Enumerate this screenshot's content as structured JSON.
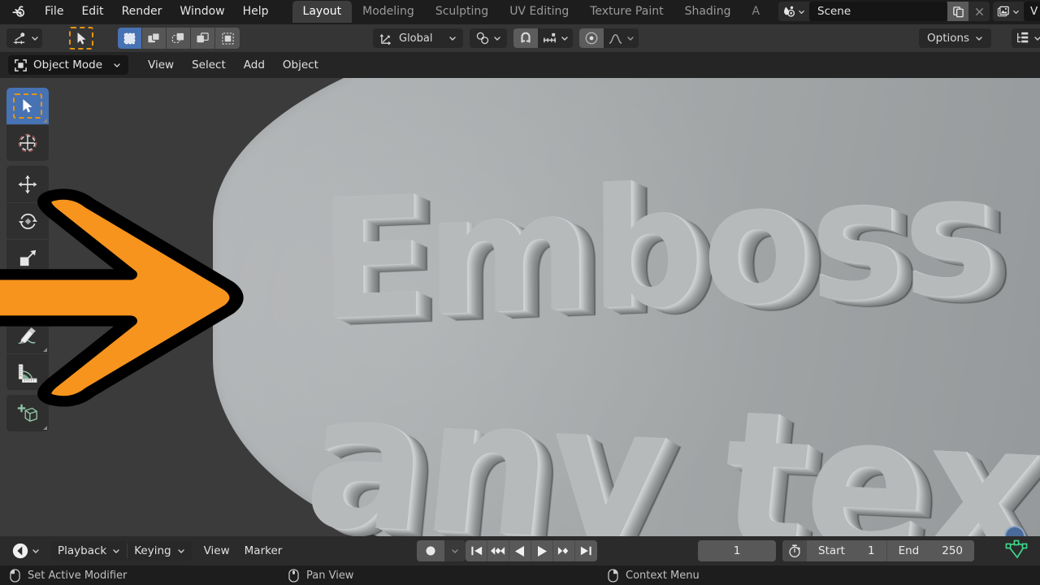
{
  "app": {
    "name": "Blender",
    "logo_icon": "blender-logo-icon"
  },
  "topbar": {
    "menus": [
      {
        "label": "File",
        "icon": ""
      },
      {
        "label": "Edit",
        "icon": ""
      },
      {
        "label": "Render",
        "icon": ""
      },
      {
        "label": "Window",
        "icon": ""
      },
      {
        "label": "Help",
        "icon": ""
      }
    ],
    "workspace_tabs": [
      {
        "label": "Layout",
        "active": true
      },
      {
        "label": "Modeling",
        "active": false
      },
      {
        "label": "Sculpting",
        "active": false
      },
      {
        "label": "UV Editing",
        "active": false
      },
      {
        "label": "Texture Paint",
        "active": false
      },
      {
        "label": "Shading",
        "active": false
      },
      {
        "label": "A",
        "active": false
      }
    ],
    "scene": {
      "icon": "scene-icon",
      "dropdown_icon": "chevron-down-icon",
      "name": "Scene",
      "duplicate_icon": "duplicate-icon",
      "close_icon": "close-icon"
    },
    "view_layer": {
      "icon": "view-layer-icon",
      "dropdown_icon": "chevron-down-icon",
      "name": "V"
    }
  },
  "tool_settings": {
    "active_tool_icon": "tweak-tool-icon",
    "active_tool_dropdown_icon": "chevron-down-icon",
    "cursor_tool_icon": "select-cursor-icon",
    "select_modes": [
      {
        "icon": "select-new-icon",
        "selected": true
      },
      {
        "icon": "select-extend-icon",
        "selected": false
      },
      {
        "icon": "select-subtract-icon",
        "selected": false
      },
      {
        "icon": "select-invert-icon",
        "selected": false
      },
      {
        "icon": "select-intersect-icon",
        "selected": false
      }
    ],
    "transform_orientation": {
      "icon": "orientation-axes-icon",
      "label": "Global",
      "dropdown_icon": "chevron-down-icon"
    },
    "pivot": {
      "icon": "pivot-point-icon",
      "dropdown_icon": "chevron-down-icon"
    },
    "snap": {
      "magnet_icon": "magnet-icon",
      "snap_to_icon": "snap-increment-icon",
      "dropdown_icon": "chevron-down-icon"
    },
    "proportional": {
      "icon": "proportional-edit-icon",
      "falloff_icon": "falloff-smooth-icon",
      "dropdown_icon": "chevron-down-icon"
    },
    "options": {
      "label": "Options",
      "dropdown_icon": "chevron-down-icon"
    },
    "outliner_filter_icon": "outliner-filter-icon"
  },
  "view_header": {
    "mode": {
      "icon": "object-mode-icon",
      "label": "Object Mode",
      "dropdown_icon": "chevron-down-icon"
    },
    "menus": [
      "View",
      "Select",
      "Add",
      "Object"
    ]
  },
  "toolbar": {
    "groups": [
      {
        "tools": [
          {
            "name": "tweak-tool",
            "icon": "cursor-arrow-icon",
            "active": true,
            "has_more": true
          },
          {
            "name": "cursor-tool",
            "icon": "3d-cursor-icon",
            "active": false,
            "has_more": false
          }
        ]
      },
      {
        "tools": [
          {
            "name": "move-tool",
            "icon": "move-arrows-icon",
            "active": false,
            "has_more": false
          },
          {
            "name": "rotate-tool",
            "icon": "rotate-icon",
            "active": false,
            "has_more": false
          },
          {
            "name": "scale-tool",
            "icon": "scale-icon",
            "active": false,
            "has_more": true
          },
          {
            "name": "transform-tool",
            "icon": "transform-icon",
            "active": false,
            "has_more": false
          }
        ]
      },
      {
        "tools": [
          {
            "name": "annotate-tool",
            "icon": "pencil-icon",
            "active": false,
            "has_more": true
          },
          {
            "name": "measure-tool",
            "icon": "ruler-icon",
            "active": false,
            "has_more": false
          }
        ]
      },
      {
        "tools": [
          {
            "name": "add-cube-tool",
            "icon": "add-cube-icon",
            "active": false,
            "has_more": true
          }
        ]
      }
    ]
  },
  "viewport": {
    "scene_text_line1": "Emboss",
    "scene_text_line2": "any text",
    "background_color": "#3b3b3b",
    "object_color": "#a9adae",
    "gizmo_icon": "navigation-gizmo-icon",
    "mesh_icon": "mesh-data-icon"
  },
  "annotation": {
    "arrow_icon": "orange-arrow-right-icon",
    "fill_color": "#F7941D",
    "outline_color": "#000000"
  },
  "timeline": {
    "editor_icon": "timeline-editor-icon",
    "editor_dropdown_icon": "chevron-down-icon",
    "menus": [
      {
        "label": "Playback",
        "has_dropdown": true
      },
      {
        "label": "Keying",
        "has_dropdown": true
      },
      {
        "label": "View",
        "has_dropdown": false
      },
      {
        "label": "Marker",
        "has_dropdown": false
      }
    ],
    "record_icon": "record-icon",
    "record_dropdown_icon": "chevron-down-icon",
    "playback_buttons": [
      {
        "name": "jump-to-start",
        "icon": "skip-start-icon"
      },
      {
        "name": "previous-keyframe",
        "icon": "prev-keyframe-icon"
      },
      {
        "name": "play-reverse",
        "icon": "play-reverse-icon"
      },
      {
        "name": "play",
        "icon": "play-icon"
      },
      {
        "name": "next-keyframe",
        "icon": "next-keyframe-icon"
      },
      {
        "name": "jump-to-end",
        "icon": "skip-end-icon"
      }
    ],
    "current_frame": "1",
    "range_icon": "timer-icon",
    "start_label": "Start",
    "start_value": "1",
    "end_label": "End",
    "end_value": "250"
  },
  "statusbar": {
    "items": [
      {
        "icon": "mouse-left-icon",
        "label": "Set Active Modifier"
      },
      {
        "icon": "mouse-middle-icon",
        "label": "Pan View"
      },
      {
        "icon": "mouse-right-icon",
        "label": "Context Menu"
      }
    ]
  }
}
